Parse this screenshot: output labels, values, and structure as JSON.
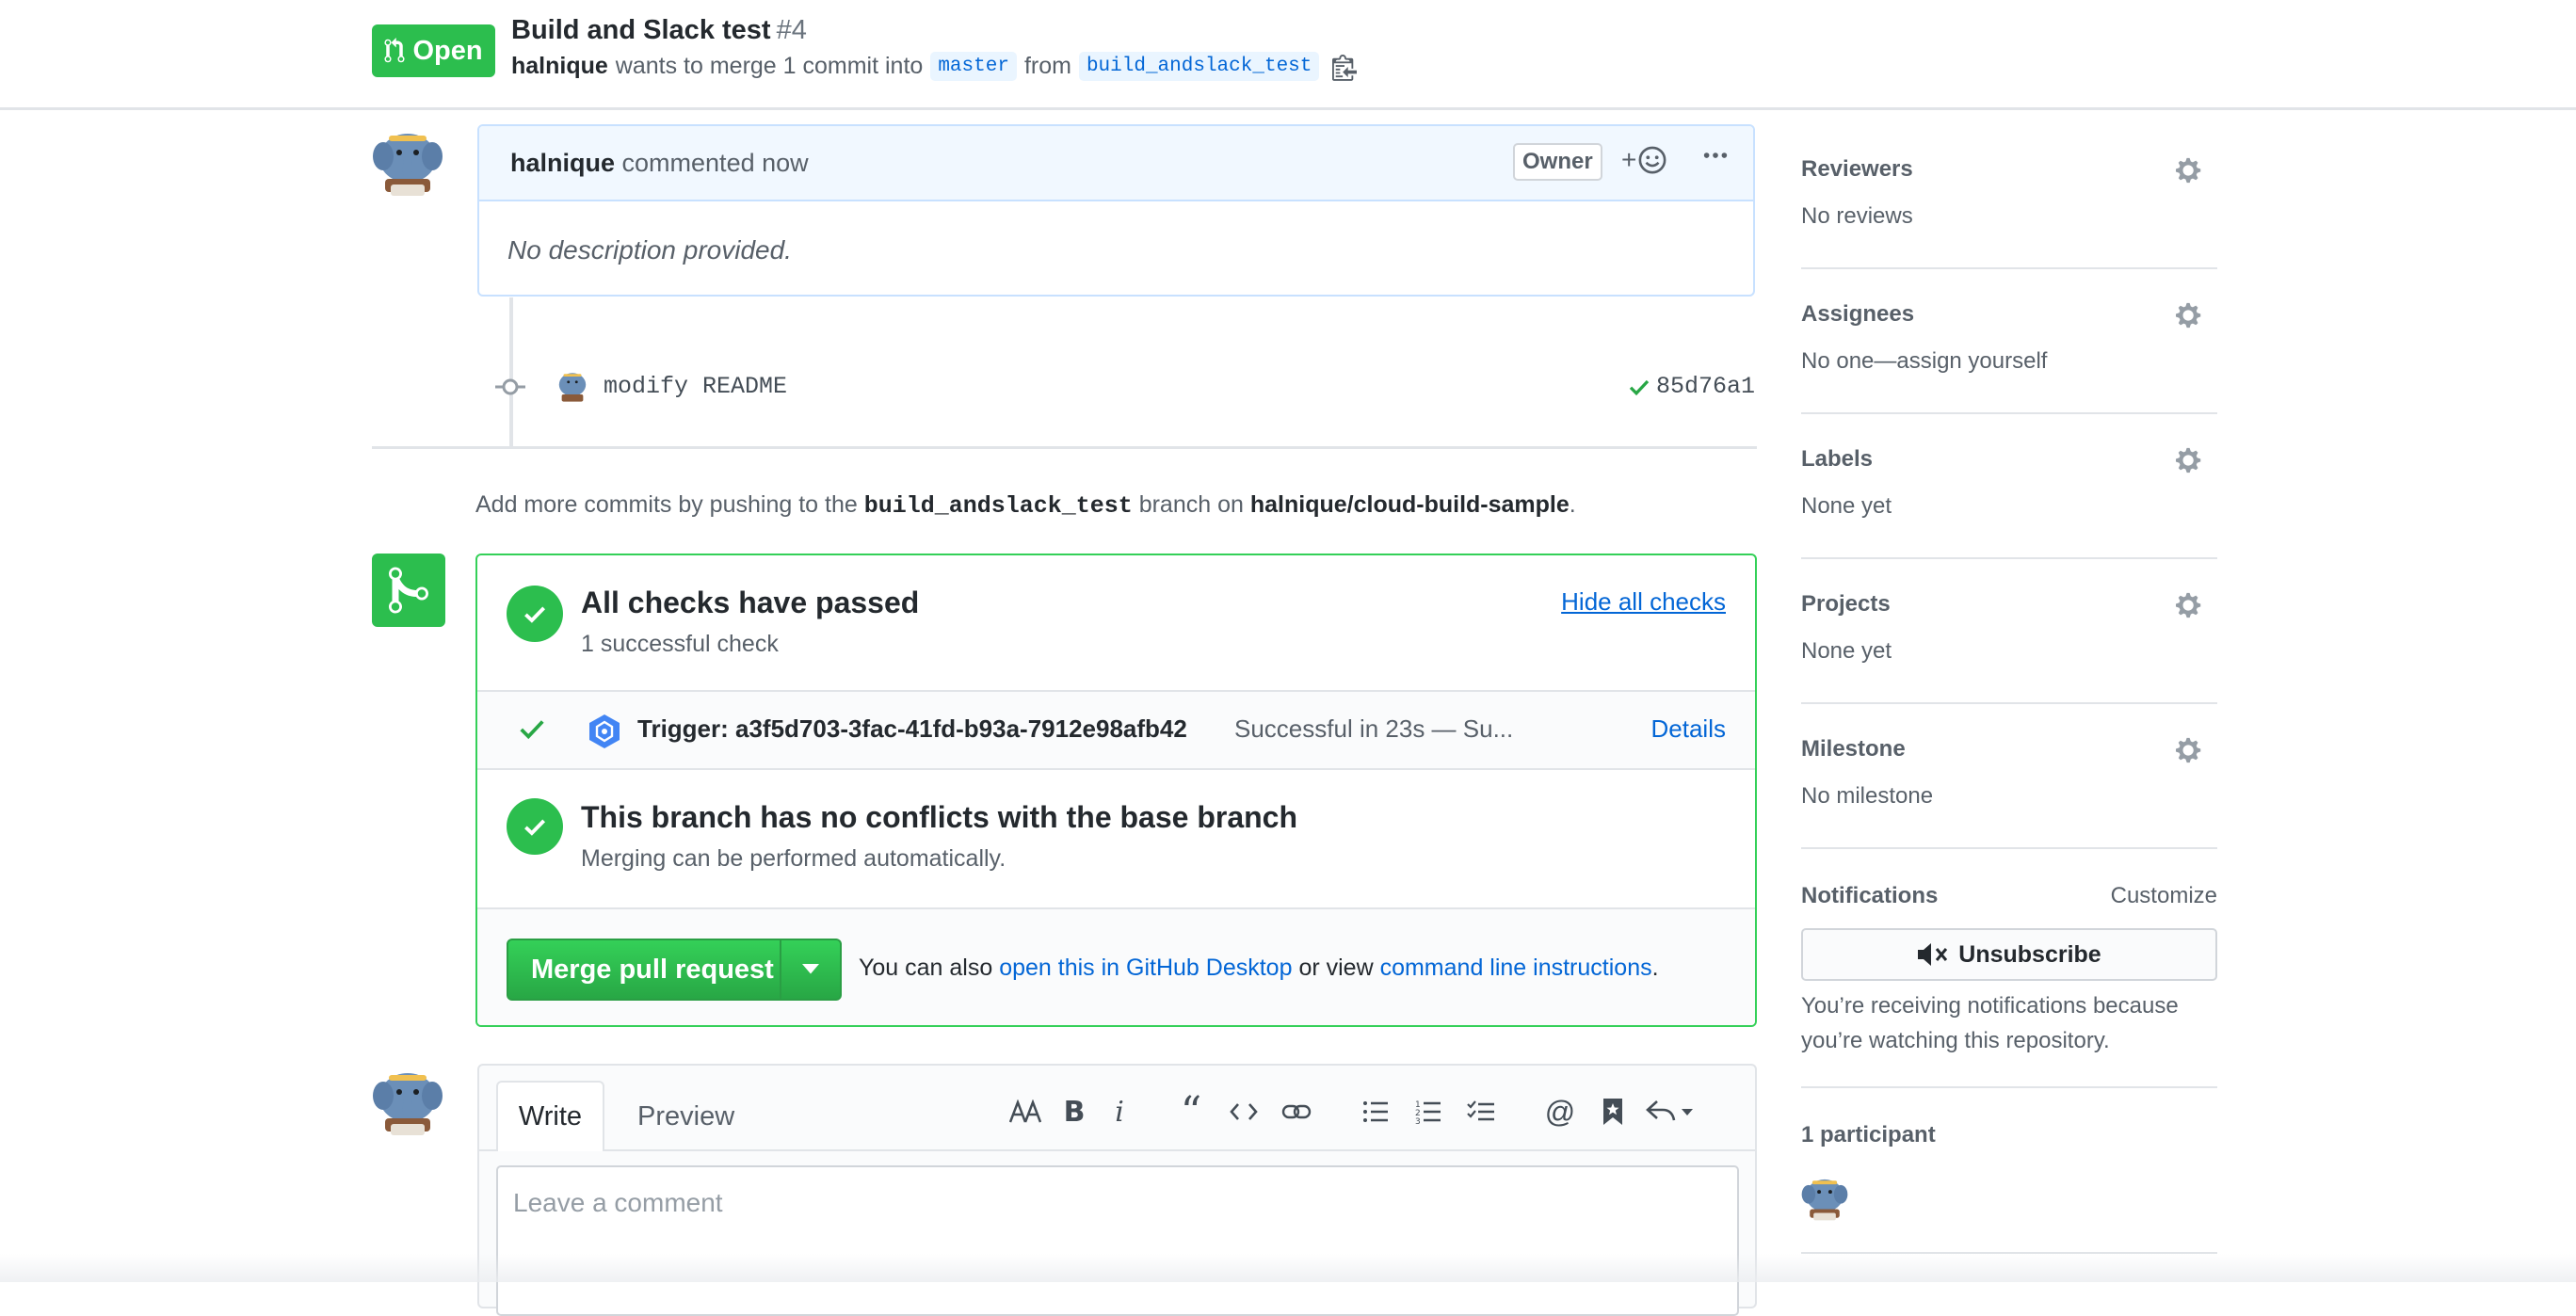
{
  "header": {
    "state": "Open",
    "title": "Build and Slack test",
    "number": "#4",
    "author": "halnique",
    "merge_text": "wants to merge 1 commit into",
    "base_branch": "master",
    "from_text": "from",
    "head_branch": "build_andslack_test"
  },
  "comment": {
    "author": "halnique",
    "action": "commented now",
    "role_label": "Owner",
    "react_plus": "+",
    "body": "No description provided."
  },
  "commit": {
    "message": "modify README",
    "sha": "85d76a1"
  },
  "push_hint": {
    "prefix": "Add more commits by pushing to the",
    "branch": "build_andslack_test",
    "middle": "branch on",
    "repo": "halnique/cloud-build-sample",
    "suffix": "."
  },
  "checks": {
    "heading": "All checks have passed",
    "sub": "1 successful check",
    "hide_link": "Hide all checks",
    "items": [
      {
        "name": "Trigger: a3f5d703-3fac-41fd-b93a-7912e98afb42",
        "description": "Successful in 23s — Su...",
        "details_link": "Details"
      }
    ]
  },
  "conflicts": {
    "heading": "This branch has no conflicts with the base branch",
    "sub": "Merging can be performed automatically."
  },
  "merge": {
    "button_label": "Merge pull request",
    "alt_prefix": "You can also",
    "desktop_link": "open this in GitHub Desktop",
    "alt_middle": "or view",
    "cli_link": "command line instructions",
    "alt_suffix": "."
  },
  "editor": {
    "tab_write": "Write",
    "tab_preview": "Preview",
    "placeholder": "Leave a comment",
    "toolbar": [
      "text-size-icon",
      "bold-icon",
      "italic-icon",
      "quote-icon",
      "code-icon",
      "link-icon",
      "bulleted-list-icon",
      "numbered-list-icon",
      "task-list-icon",
      "mention-icon",
      "saved-reply-icon",
      "reply-icon"
    ]
  },
  "sidebar": {
    "reviewers": {
      "title": "Reviewers",
      "value": "No reviews"
    },
    "assignees": {
      "title": "Assignees",
      "value": "No one—assign yourself"
    },
    "labels": {
      "title": "Labels",
      "value": "None yet"
    },
    "projects": {
      "title": "Projects",
      "value": "None yet"
    },
    "milestone": {
      "title": "Milestone",
      "value": "No milestone"
    },
    "notifications": {
      "title": "Notifications",
      "customize": "Customize",
      "button": "Unsubscribe",
      "reason": "You’re receiving notifications because you’re watching this repository."
    },
    "participants": {
      "title": "1 participant"
    }
  },
  "colors": {
    "green": "#2cbe4e",
    "link_blue": "#0366d6",
    "comment_header_bg": "#f1f8ff"
  }
}
